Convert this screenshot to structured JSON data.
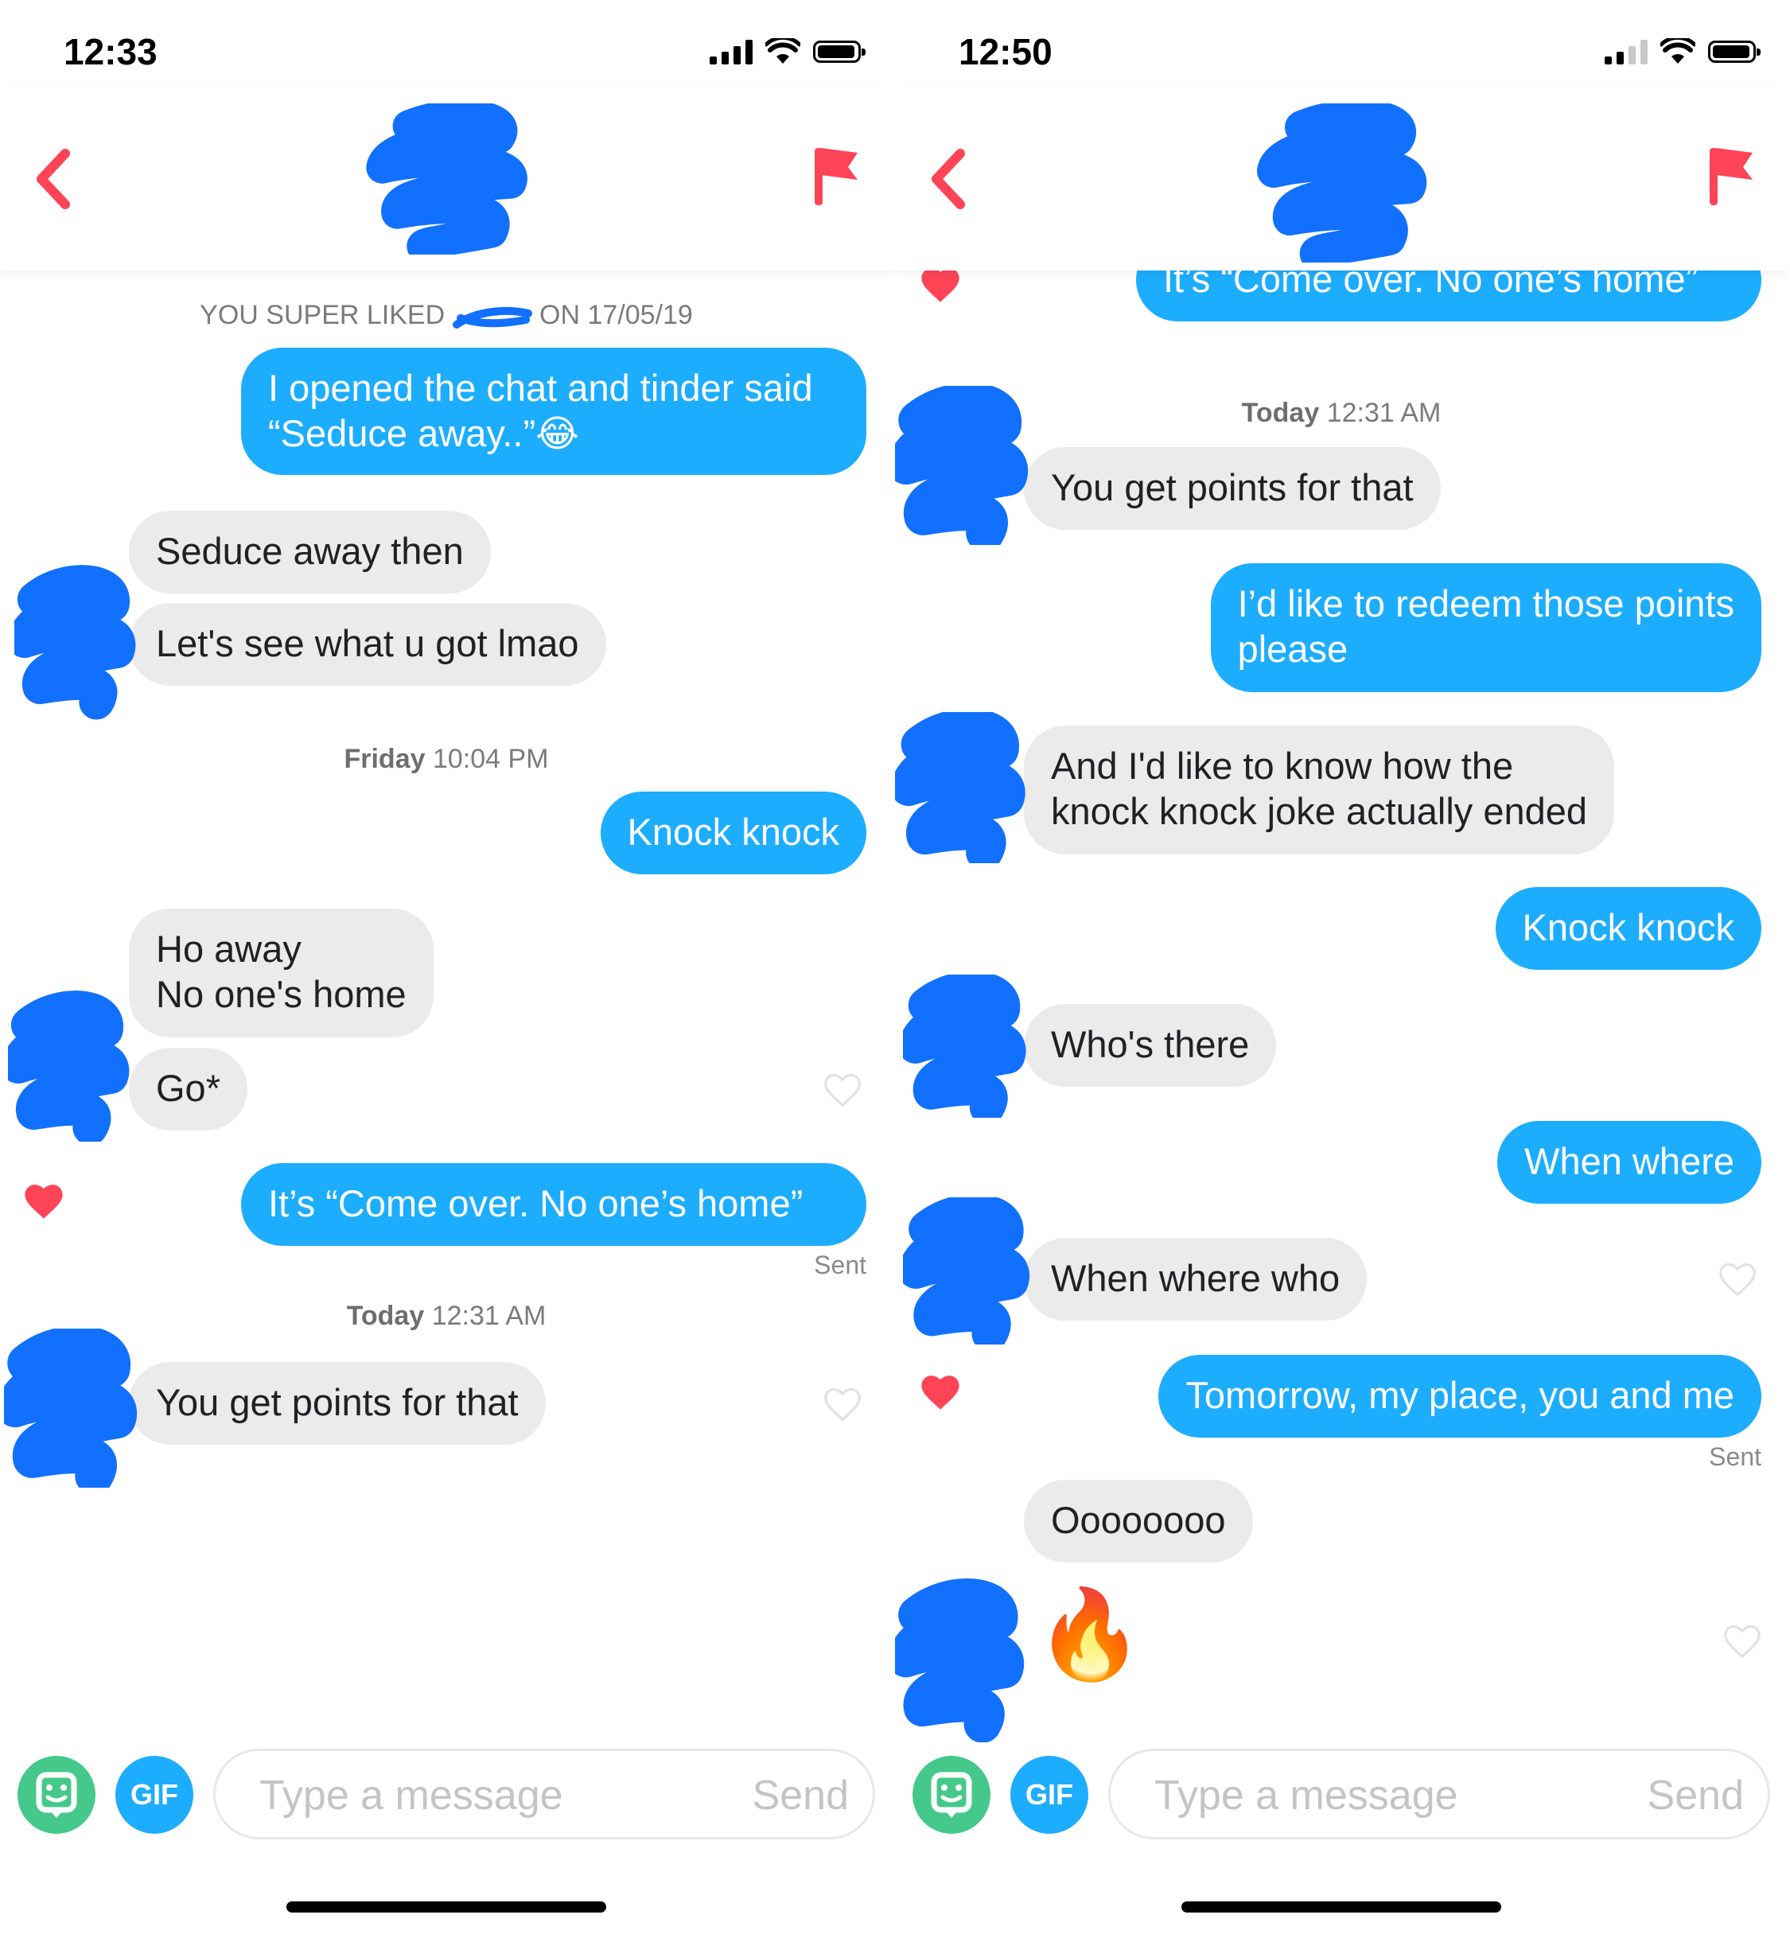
{
  "colors": {
    "outgoing": "#1dadff",
    "incoming": "#ebebeb",
    "accent": "#ff4458",
    "sticker": "#45c98a",
    "scribble": "#1270ff"
  },
  "left": {
    "status": {
      "time": "12:33"
    },
    "header": {
      "back_icon": "chevron-left-icon",
      "report_icon": "flag-icon"
    },
    "chat": {
      "super_like_prefix": "YOU SUPER LIKED",
      "super_like_suffix": "ON 17/05/19",
      "ts_friday_day": "Friday",
      "ts_friday_time": "10:04 PM",
      "ts_today_day": "Today",
      "ts_today_time": "12:31 AM",
      "m1": "I opened the chat and tinder said\n“Seduce away..”😂",
      "m2": "Seduce away then",
      "m3": "Let's see what u got lmao",
      "m4": "Knock knock",
      "m5": "Ho away\nNo one's home",
      "m6": "Go*",
      "m7": "It’s “Come over. No one’s home”",
      "sent": "Sent",
      "m8": "You get points for that"
    },
    "composer": {
      "gif": "GIF",
      "placeholder": "Type a message",
      "send": "Send"
    }
  },
  "right": {
    "status": {
      "time": "12:50"
    },
    "header": {
      "back_icon": "chevron-left-icon",
      "report_icon": "flag-icon"
    },
    "chat": {
      "m1": "It’s “Come over. No one’s home”",
      "ts_today_day": "Today",
      "ts_today_time": "12:31 AM",
      "m2": "You get points for that",
      "m3": "I’d like to redeem those points\nplease",
      "m4": "And I'd like to know how the\nknock knock joke actually ended",
      "m5": "Knock knock",
      "m6": "Who's there",
      "m7": "When where",
      "m8": "When where who",
      "m9": "Tomorrow, my place, you and me",
      "sent": "Sent",
      "m10": "Oooooooo",
      "m11": "🔥"
    },
    "composer": {
      "gif": "GIF",
      "placeholder": "Type a message",
      "send": "Send"
    }
  }
}
